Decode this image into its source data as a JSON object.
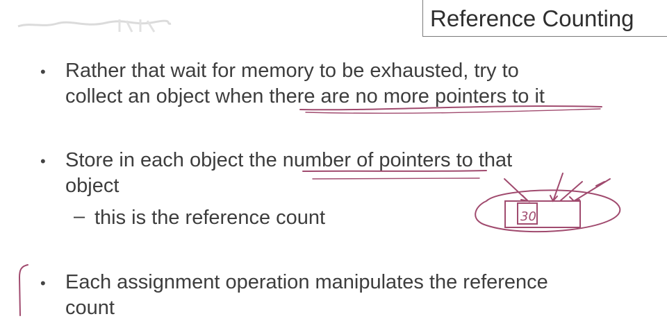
{
  "title": "Reference Counting",
  "bullets": [
    {
      "line1": "Rather that wait for memory to be exhausted, try to",
      "line2": "collect an object when there are no more pointers to it"
    },
    {
      "line1": "Store in each object the number of pointers to that",
      "line2": "object",
      "sub": "this is the reference count"
    },
    {
      "line1": "Each assignment operation manipulates the reference",
      "line2": "count"
    }
  ],
  "annotation": {
    "count_value": "30",
    "ink_color": "#a04a6e"
  }
}
